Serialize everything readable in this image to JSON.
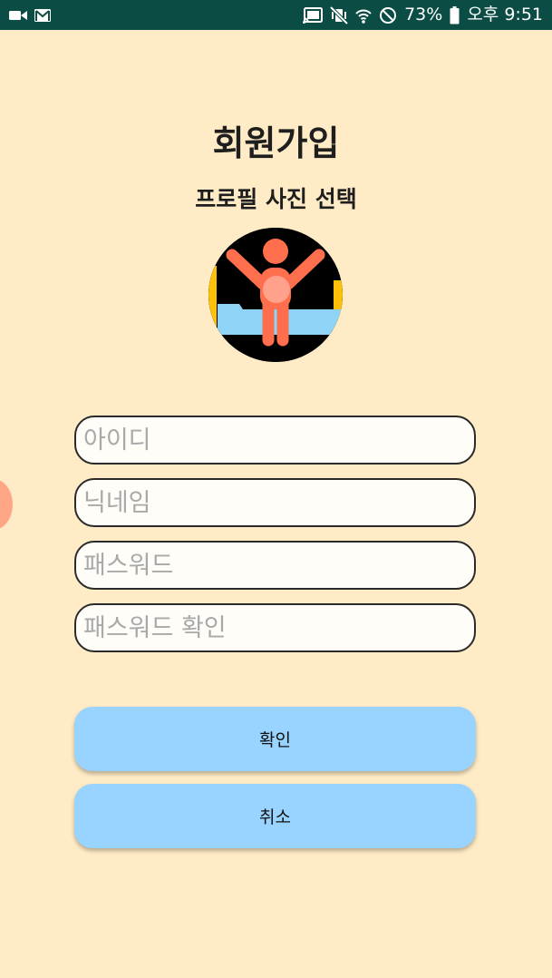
{
  "status_bar": {
    "icons_left": [
      "video-camera-icon",
      "gmail-icon"
    ],
    "icons_right": [
      "cast-icon",
      "vibrate-mute-icon",
      "wifi-icon",
      "do-not-disturb-icon",
      "battery-icon"
    ],
    "battery": "73%",
    "time": "오후 9:51"
  },
  "signup": {
    "title": "회원가입",
    "profile_label": "프로필 사진 선택",
    "avatar_icon": "person-arms-raised-icon",
    "fields": {
      "id_placeholder": "아이디",
      "nickname_placeholder": "닉네임",
      "password_placeholder": "패스워드",
      "password_confirm_placeholder": "패스워드 확인"
    },
    "confirm_label": "확인",
    "cancel_label": "취소"
  },
  "colors": {
    "background": "#ffecc6",
    "status_bar": "#0b4d45",
    "button": "#99d3ff",
    "avatar_figure": "#ff6f4e"
  }
}
